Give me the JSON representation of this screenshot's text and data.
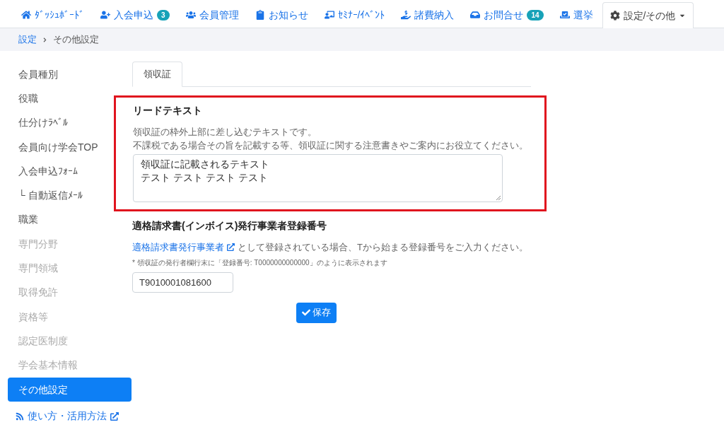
{
  "nav": [
    {
      "label": "ﾀﾞｯｼｭﾎﾞｰﾄﾞ",
      "selected": false
    },
    {
      "label": "入会申込",
      "badge": "3",
      "selected": false
    },
    {
      "label": "会員管理",
      "selected": false
    },
    {
      "label": "お知らせ",
      "selected": false
    },
    {
      "label": "ｾﾐﾅｰ/ｲﾍﾞﾝﾄ",
      "selected": false
    },
    {
      "label": "諸費納入",
      "selected": false
    },
    {
      "label": "お問合せ",
      "badge": "14",
      "selected": false
    },
    {
      "label": "選挙",
      "selected": false
    },
    {
      "label": "設定/その他",
      "dropdown": true,
      "selected": true
    }
  ],
  "breadcrumb": [
    {
      "label": "設定",
      "link": true
    },
    {
      "label": "その他設定",
      "link": false
    }
  ],
  "sidebar": {
    "items": [
      {
        "label": "会員種別",
        "disabled": false,
        "selected": false
      },
      {
        "label": "役職",
        "disabled": false,
        "selected": false
      },
      {
        "label": "仕分けﾗﾍﾞﾙ",
        "disabled": false,
        "selected": false
      },
      {
        "label": "会員向け学会TOP",
        "disabled": false,
        "selected": false
      },
      {
        "label": "入会申込ﾌｫｰﾑ",
        "disabled": false,
        "selected": false
      },
      {
        "label": "└ 自動返信ﾒｰﾙ",
        "disabled": false,
        "selected": false
      },
      {
        "label": "職業",
        "disabled": false,
        "selected": false
      },
      {
        "label": "専門分野",
        "disabled": true,
        "selected": false
      },
      {
        "label": "専門領域",
        "disabled": true,
        "selected": false
      },
      {
        "label": "取得免許",
        "disabled": true,
        "selected": false
      },
      {
        "label": "資格等",
        "disabled": true,
        "selected": false
      },
      {
        "label": "認定医制度",
        "disabled": true,
        "selected": false
      },
      {
        "label": "学会基本情報",
        "disabled": true,
        "selected": false
      },
      {
        "label": "その他設定",
        "disabled": false,
        "selected": true
      }
    ],
    "help_link": "使い方・活用方法"
  },
  "tabs": [
    {
      "label": "領収証",
      "selected": true
    }
  ],
  "lead_text": {
    "title": "リードテキスト",
    "highlighted": true,
    "description": [
      "領収証の枠外上部に差し込むテキストです。",
      "不課税である場合その旨を記載する等、領収証に関する注意書きやご案内にお役立てください。"
    ],
    "lines": [
      "領収証に記載されるテキスト",
      "テスト テスト テスト テスト"
    ]
  },
  "invoice": {
    "title": "適格請求書(インボイス)発行事業者登録番号",
    "link": "適格請求書発行事業者",
    "description": "として登録されている場合、Tから始まる登録番号をご入力ください。",
    "note": "* 領収証の発行者欄行末に「登録番号: T0000000000000」のように表示されます",
    "value": "T9010001081600"
  },
  "save_button": "保存"
}
